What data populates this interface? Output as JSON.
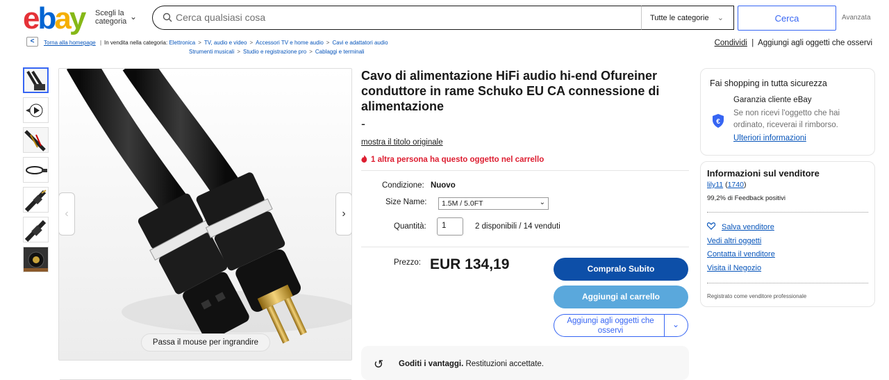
{
  "header": {
    "logo": [
      "e",
      "b",
      "a",
      "y"
    ],
    "category_label": "Scegli la categoria",
    "search_placeholder": "Cerca qualsiasi cosa",
    "category_select": "Tutte le categorie",
    "search_button": "Cerca",
    "advanced": "Avanzata"
  },
  "breadcrumb": {
    "back": "Torna alla homepage",
    "prefix": "In vendita nella categoria:",
    "items": [
      "Elettronica",
      "TV, audio e video",
      "Accessori TV e home audio",
      "Cavi e adattatori audio",
      "Strumenti musicali",
      "Studio e registrazione pro",
      "Cablaggi e terminali"
    ],
    "share": "Condividi",
    "watch": "Aggiungi agli oggetti che osservi"
  },
  "gallery": {
    "zoom_hint": "Passa il mouse per ingrandire"
  },
  "product": {
    "title": "Cavo di alimentazione HiFi audio hi-end Ofureiner conduttore in rame Schuko EU CA connessione di alimentazione",
    "dash": "-",
    "show_original": "mostra il titolo originale",
    "cart_note": "1 altra persona ha questo oggetto nel carrello",
    "condition_label": "Condizione:",
    "condition_value": "Nuovo",
    "size_label": "Size Name:",
    "size_value": "1.5M / 5.0FT",
    "qty_label": "Quantità:",
    "qty_value": "1",
    "availability": "2 disponibili / 14 venduti",
    "price_label": "Prezzo:",
    "price": "EUR 134,19",
    "buy_now": "Compralo Subito",
    "add_cart": "Aggiungi al carrello",
    "add_watch": "Aggiungi agli oggetti che osservi",
    "returns_bold": "Goditi i vantaggi.",
    "returns_text": "Restituzioni accettate."
  },
  "safety_card": {
    "title": "Fai shopping in tutta sicurezza",
    "guarantee_title": "Garanzia cliente eBay",
    "guarantee_desc": "Se non ricevi l'oggetto che hai ordinato, riceverai il rimborso.",
    "more": "Ulteriori informazioni"
  },
  "seller_card": {
    "title": "Informazioni sul venditore",
    "seller_name": "lily11",
    "seller_score": "1740",
    "feedback": "99,2% di Feedback positivi",
    "save_seller": "Salva venditore",
    "other_items": "Vedi altri oggetti",
    "contact": "Contatta il venditore",
    "store": "Visita il Negozio",
    "registered": "Registrato come venditore professionale"
  },
  "colors": {
    "primary_blue": "#3665f3",
    "buy_button": "#0d4fa8",
    "cart_button": "#5aa8dc",
    "alert_red": "#dd1e31"
  }
}
